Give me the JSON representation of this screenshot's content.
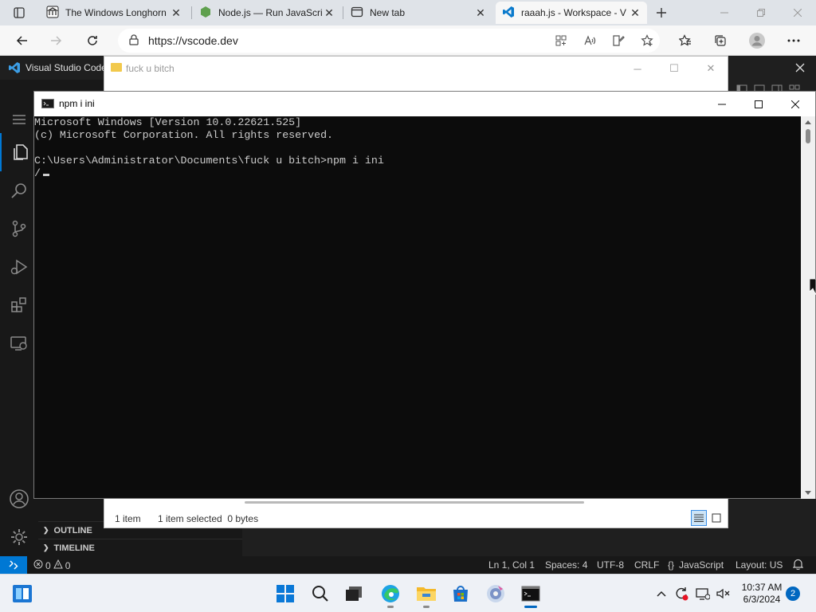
{
  "browser": {
    "tabs": [
      {
        "label": "The Windows Longhorn",
        "icon": "page-building-icon",
        "active": false
      },
      {
        "label": "Node.js — Run JavaScri",
        "icon": "nodejs-icon",
        "active": false
      },
      {
        "label": "New tab",
        "icon": "new-tab-page-icon",
        "active": false
      },
      {
        "label": "raaah.js - Workspace - V",
        "icon": "vscode-icon",
        "active": true
      }
    ],
    "url": "https://vscode.dev"
  },
  "vscode": {
    "title": "Visual Studio Code",
    "activity": [
      "menu-icon",
      "explorer-icon",
      "search-icon",
      "source-control-icon",
      "run-debug-icon",
      "extensions-icon",
      "remote-explorer-icon",
      "accounts-icon",
      "manage-gear-icon"
    ],
    "sections": {
      "outline": "OUTLINE",
      "timeline": "TIMELINE"
    },
    "statusbar": {
      "errors": "0",
      "warnings": "0",
      "position": "Ln 1, Col 1",
      "spaces": "Spaces: 4",
      "encoding": "UTF-8",
      "eol": "CRLF",
      "language": "JavaScript",
      "layout": "Layout: US"
    }
  },
  "explorer_window": {
    "title": "fuck u bitch",
    "items": "1 item",
    "selected": "1 item selected  0 bytes"
  },
  "console_window": {
    "title": "npm i ini",
    "lines": [
      "Microsoft Windows [Version 10.0.22621.525]",
      "(c) Microsoft Corporation. All rights reserved.",
      "",
      "C:\\Users\\Administrator\\Documents\\fuck u bitch>npm i ini",
      "/"
    ]
  },
  "taskbar": {
    "apps": [
      "start-icon",
      "search-icon",
      "task-view-icon",
      "edge-icon",
      "file-explorer-icon",
      "store-icon",
      "media-player-icon",
      "terminal-icon"
    ],
    "time": "10:37 AM",
    "date": "6/3/2024",
    "notifications": "2"
  },
  "colors": {
    "vscode_accent": "#0078d4",
    "console_bg": "#0c0c0c",
    "taskbar_bg": "#eef1f6"
  }
}
